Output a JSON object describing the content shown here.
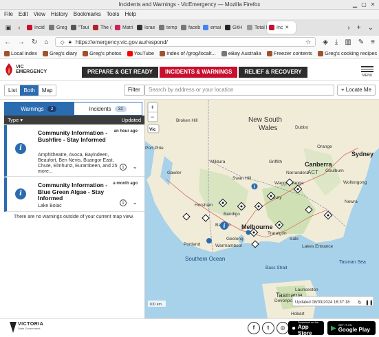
{
  "browser": {
    "window_title": "Incidents and Warnings - VicEmergency — Mozilla Firefox",
    "menu": [
      "File",
      "Edit",
      "View",
      "History",
      "Bookmarks",
      "Tools",
      "Help"
    ],
    "tabs": [
      {
        "label": "Incid",
        "color": "#c8102e"
      },
      {
        "label": "Greg",
        "color": "#777777"
      },
      {
        "label": "\"Taui",
        "color": "#555555"
      },
      {
        "label": "The (",
        "color": "#b22222"
      },
      {
        "label": "Matri",
        "color": "#cc2255"
      },
      {
        "label": "Israe",
        "color": "#333333"
      },
      {
        "label": "temp",
        "color": "#777777"
      },
      {
        "label": "faceb",
        "color": "#777777"
      },
      {
        "label": "emai",
        "color": "#4285f4"
      },
      {
        "label": "GitH",
        "color": "#222222"
      },
      {
        "label": "Total F",
        "color": "#999999"
      },
      {
        "label": "Inc",
        "color": "#c8102e",
        "active": true
      }
    ],
    "url": "https://emergency.vic.gov.au/respond/",
    "bookmarks": [
      {
        "label": "Local index",
        "color": "#a0522d"
      },
      {
        "label": "Greg's diary",
        "color": "#a0522d"
      },
      {
        "label": "Greg's photos",
        "color": "#a0522d"
      },
      {
        "label": "YouTube",
        "color": "#ff0000"
      },
      {
        "label": "Index of /grog/localt...",
        "color": "#a0522d"
      },
      {
        "label": "eBay Australia",
        "color": "#777777"
      },
      {
        "label": "Freezer contents",
        "color": "#a0522d"
      },
      {
        "label": "Greg's cooking recipes",
        "color": "#a0522d"
      }
    ]
  },
  "site": {
    "logo_line1": "VIC",
    "logo_line2": "EMERGENCY",
    "nav": [
      {
        "label": "PREPARE & GET READY"
      },
      {
        "label": "INCIDENTS & WARNINGS",
        "active": true
      },
      {
        "label": "RELIEF & RECOVERY"
      }
    ],
    "menu_label": "MENU"
  },
  "controls": {
    "views": [
      "List",
      "Both",
      "Map"
    ],
    "active_view": "Both",
    "filter_label": "Filter",
    "search_placeholder": "Search by address or your location",
    "locate_label": "Locate Me"
  },
  "panel": {
    "tabs": [
      {
        "label": "Warnings",
        "count": "2",
        "active": true
      },
      {
        "label": "Incidents",
        "count": "32"
      }
    ],
    "col_type": "Type",
    "col_updated": "Updated",
    "warnings": [
      {
        "title": "Community Information - Bushfire - Stay Informed",
        "age": "an hour ago",
        "description": "Amphitheatre, Avoca, Bayindeen, Beaufort, Ben Nevis, Buangor East, Chute, Elmhurst, Eurambeen, and 25 more..."
      },
      {
        "title": "Community Information - Blue Green Algae - Stay Informed",
        "age": "a month ago",
        "description": "Lake Bolac"
      }
    ],
    "no_more": "There are no warnings outside of your current map view."
  },
  "map": {
    "labels": {
      "new_south_wales": "New South Wales",
      "vic": "Vic",
      "melbourne": "Melbourne",
      "canberra": "Canberra",
      "act": "ACT",
      "sydney": "Sydney",
      "southern_ocean": "Southern Ocean",
      "tasmania": "Tasmania",
      "broken_hill": "Broken Hill",
      "dubbo": "Dubbo",
      "orange": "Orange",
      "griffith": "Griffith",
      "mildura": "Mildura",
      "swan_hill": "Swan Hill",
      "wagga": "Wagga Wagga",
      "albury": "Albury",
      "bendigo": "Bendigo",
      "ballarat": "Ballarat",
      "geelong": "Geelong",
      "horsham": "Horsham",
      "portland": "Portland",
      "warrnambool": "Warrnambool",
      "traralgon": "Traralgon",
      "wollongong": "Wollongong",
      "nowra": "Nowra",
      "goulburn": "Goulburn",
      "bass_strait": "Bass Strait",
      "tasman_sea": "Tasman Sea",
      "devonport": "Devonport",
      "launceston": "Launceston",
      "hobart": "Hobart",
      "gawler": "Gawler",
      "port_pirie": "Port Pirie",
      "narrandera": "Narrandera",
      "sale": "Sale",
      "lakes_entrance": "Lakes Entrance"
    },
    "scale": "100 km",
    "updated": "Updated 08/03/2024 16:37:18",
    "zoom_in": "+",
    "zoom_out": "−"
  },
  "footer": {
    "brand": "VICTORIA",
    "brand_sub": "State Government",
    "social": [
      "f",
      "t",
      "◎"
    ],
    "app_store_small": "Download on the",
    "app_store": "App Store",
    "google_play_small": "GET IT ON",
    "google_play": "Google Play"
  }
}
